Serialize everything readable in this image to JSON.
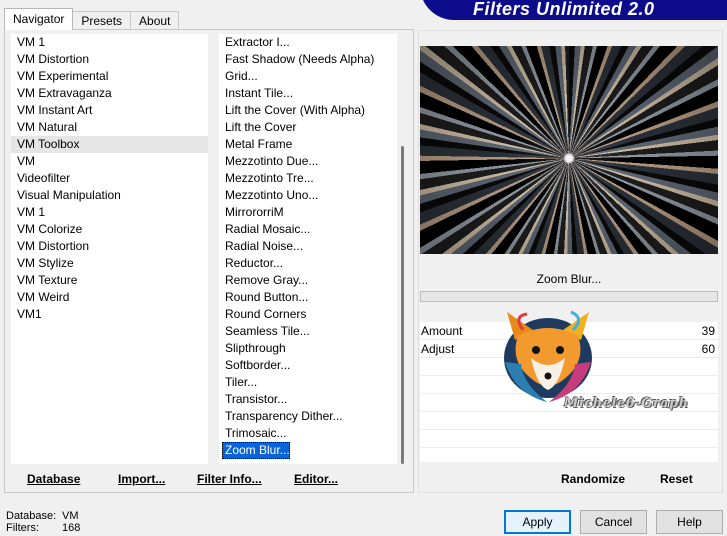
{
  "tabs": [
    {
      "label": "Navigator",
      "active": true
    },
    {
      "label": "Presets",
      "active": false
    },
    {
      "label": "About",
      "active": false
    }
  ],
  "title": "Filters Unlimited 2.0",
  "categories": [
    {
      "label": "VM 1"
    },
    {
      "label": "VM Distortion"
    },
    {
      "label": "VM Experimental"
    },
    {
      "label": "VM Extravaganza"
    },
    {
      "label": "VM Instant Art"
    },
    {
      "label": "VM Natural"
    },
    {
      "label": "VM Toolbox",
      "highlighted": true
    },
    {
      "label": "VM"
    },
    {
      "label": "Videofilter"
    },
    {
      "label": "Visual Manipulation"
    },
    {
      "label": "VM 1"
    },
    {
      "label": "VM Colorize"
    },
    {
      "label": "VM Distortion"
    },
    {
      "label": "VM Stylize"
    },
    {
      "label": "VM Texture"
    },
    {
      "label": "VM Weird"
    },
    {
      "label": "VM1"
    }
  ],
  "filters": [
    {
      "label": "Extractor I..."
    },
    {
      "label": "Fast Shadow (Needs Alpha)"
    },
    {
      "label": "Grid..."
    },
    {
      "label": "Instant Tile..."
    },
    {
      "label": "Lift the Cover (With Alpha)"
    },
    {
      "label": "Lift the Cover"
    },
    {
      "label": "Metal Frame"
    },
    {
      "label": "Mezzotinto Due..."
    },
    {
      "label": "Mezzotinto Tre..."
    },
    {
      "label": "Mezzotinto Uno..."
    },
    {
      "label": "MirrororriM"
    },
    {
      "label": "Radial Mosaic..."
    },
    {
      "label": "Radial Noise..."
    },
    {
      "label": "Reductor..."
    },
    {
      "label": "Remove Gray..."
    },
    {
      "label": "Round Button..."
    },
    {
      "label": "Round Corners"
    },
    {
      "label": "Seamless Tile..."
    },
    {
      "label": "Slipthrough"
    },
    {
      "label": "Softborder..."
    },
    {
      "label": "Tiler..."
    },
    {
      "label": "Transistor..."
    },
    {
      "label": "Transparency Dither..."
    },
    {
      "label": "Trimosaic..."
    },
    {
      "label": "Zoom Blur...",
      "selected": true
    }
  ],
  "left_buttons": {
    "database": "Database",
    "import": "Import...",
    "filter_info": "Filter Info...",
    "editor": "Editor..."
  },
  "selected_filter_name": "Zoom Blur...",
  "params": [
    {
      "label": "Amount",
      "value": "39"
    },
    {
      "label": "Adjust",
      "value": "60"
    },
    {
      "label": "",
      "value": ""
    },
    {
      "label": "",
      "value": ""
    },
    {
      "label": "",
      "value": ""
    },
    {
      "label": "",
      "value": ""
    },
    {
      "label": "",
      "value": ""
    }
  ],
  "watermark": "Michele6-Graph",
  "right_buttons": {
    "randomize": "Randomize",
    "reset": "Reset"
  },
  "status": {
    "database_label": "Database:",
    "database_value": "VM",
    "filters_label": "Filters:",
    "filters_value": "168"
  },
  "dialog_buttons": {
    "apply": "Apply",
    "cancel": "Cancel",
    "help": "Help"
  },
  "colors": {
    "title_bar": "#0b0b8c",
    "selection": "#0a64d8",
    "apply_border": "#0078d7"
  }
}
